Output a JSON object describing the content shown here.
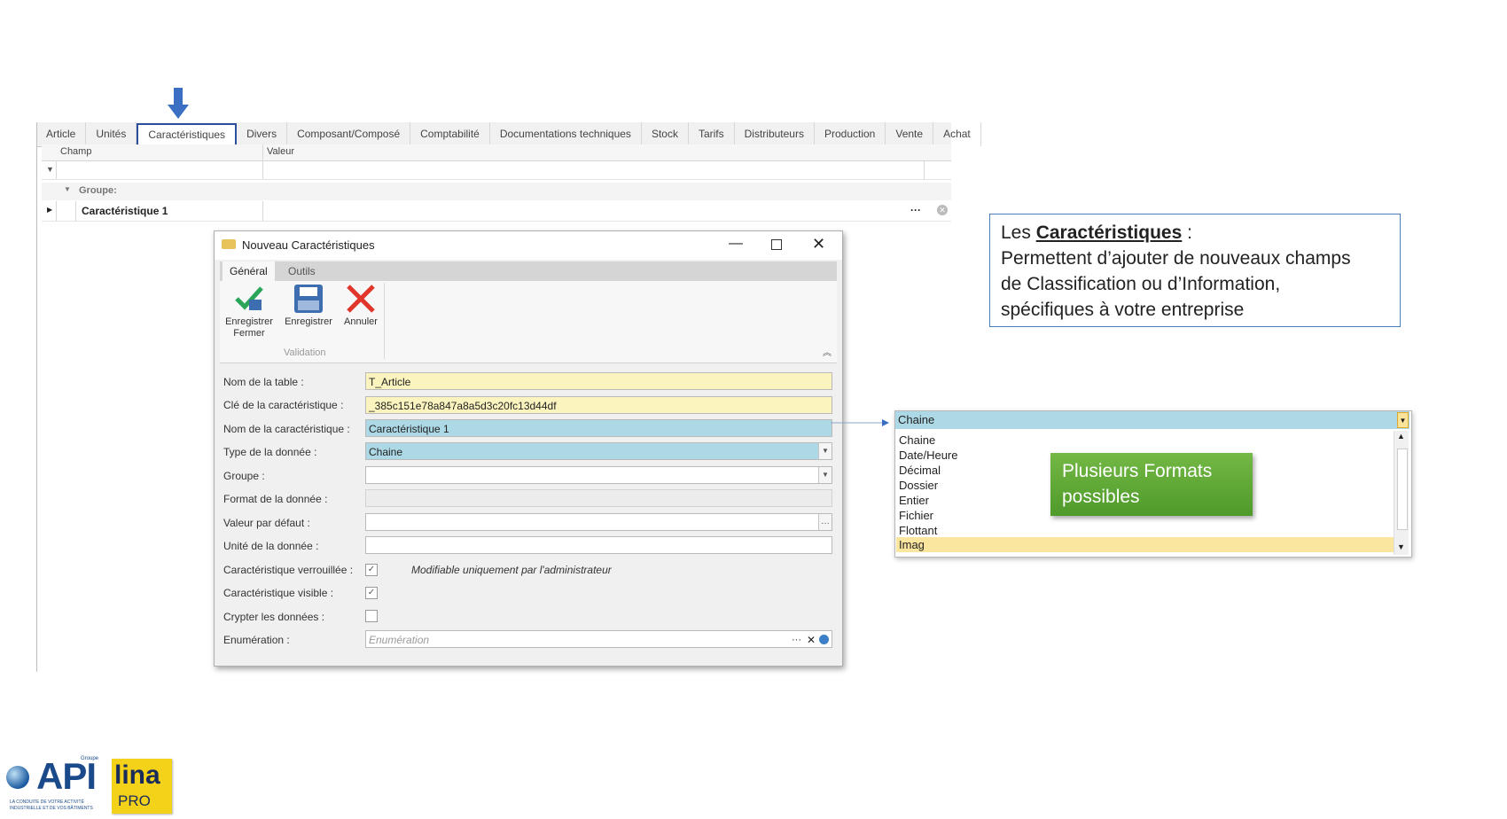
{
  "tabs": [
    "Article",
    "Unités",
    "Caractéristiques",
    "Divers",
    "Composant/Composé",
    "Comptabilité",
    "Documentations techniques",
    "Stock",
    "Tarifs",
    "Distributeurs",
    "Production",
    "Vente",
    "Achat"
  ],
  "grid": {
    "col_champ": "Champ",
    "col_valeur": "Valeur",
    "group_label": "Groupe:",
    "row_label": "Caractéristique 1",
    "row_ellipsis": "···"
  },
  "dialog": {
    "title": "Nouveau Caractéristiques",
    "ribbon_tabs": [
      "Général",
      "Outils"
    ],
    "buttons": {
      "save_close_1": "Enregistrer",
      "save_close_2": "Fermer",
      "save": "Enregistrer",
      "cancel": "Annuler"
    },
    "group_label": "Validation",
    "fields": {
      "table_name_label": "Nom de la table :",
      "table_name_value": "T_Article",
      "key_label": "Clé de la caractéristique :",
      "key_value": "_385c151e78a847a8a5d3c20fc13d44df",
      "name_label": "Nom de la caractéristique :",
      "name_value": "Caractéristique 1",
      "type_label": "Type de la donnée :",
      "type_value": "Chaine",
      "group_label": "Groupe :",
      "format_label": "Format de la donnée :",
      "default_label": "Valeur par défaut :",
      "unit_label": "Unité de la donnée :",
      "locked_label": "Caractéristique verrouillée :",
      "locked_note": "Modifiable uniquement par l'administrateur",
      "visible_label": "Caractéristique visible :",
      "encrypt_label": "Crypter les données :",
      "enum_label": "Enumération :",
      "enum_placeholder": "Enumération"
    }
  },
  "callout": {
    "prefix": "Les ",
    "title": "Caractéristiques",
    "suffix": " :",
    "lines": [
      "Permettent d’ajouter de nouveaux champs",
      "de Classification ou d’Information,",
      "spécifiques à votre entreprise"
    ]
  },
  "dropdown": {
    "selected": "Chaine",
    "options": [
      "Chaine",
      "Date/Heure",
      "Décimal",
      "Dossier",
      "Entier",
      "Fichier",
      "Flottant",
      "Imag"
    ]
  },
  "green_note": [
    "Plusieurs Formats",
    "possibles"
  ],
  "logos": {
    "api_small": "Groupe",
    "api": "API",
    "api_tagline_1": "LA CONDUITE DE VOTRE ACTIVITÉ",
    "api_tagline_2": "INDUSTRIELLE ET DE VOS BÂTIMENTS",
    "lina": "lina",
    "pro": "PRO"
  },
  "colors": {
    "accent_blue": "#2c4f9c",
    "field_yellow": "#fbf4bf",
    "field_blue": "#add8e6",
    "green": "#5fa836",
    "cancel_red": "#e0362c"
  }
}
